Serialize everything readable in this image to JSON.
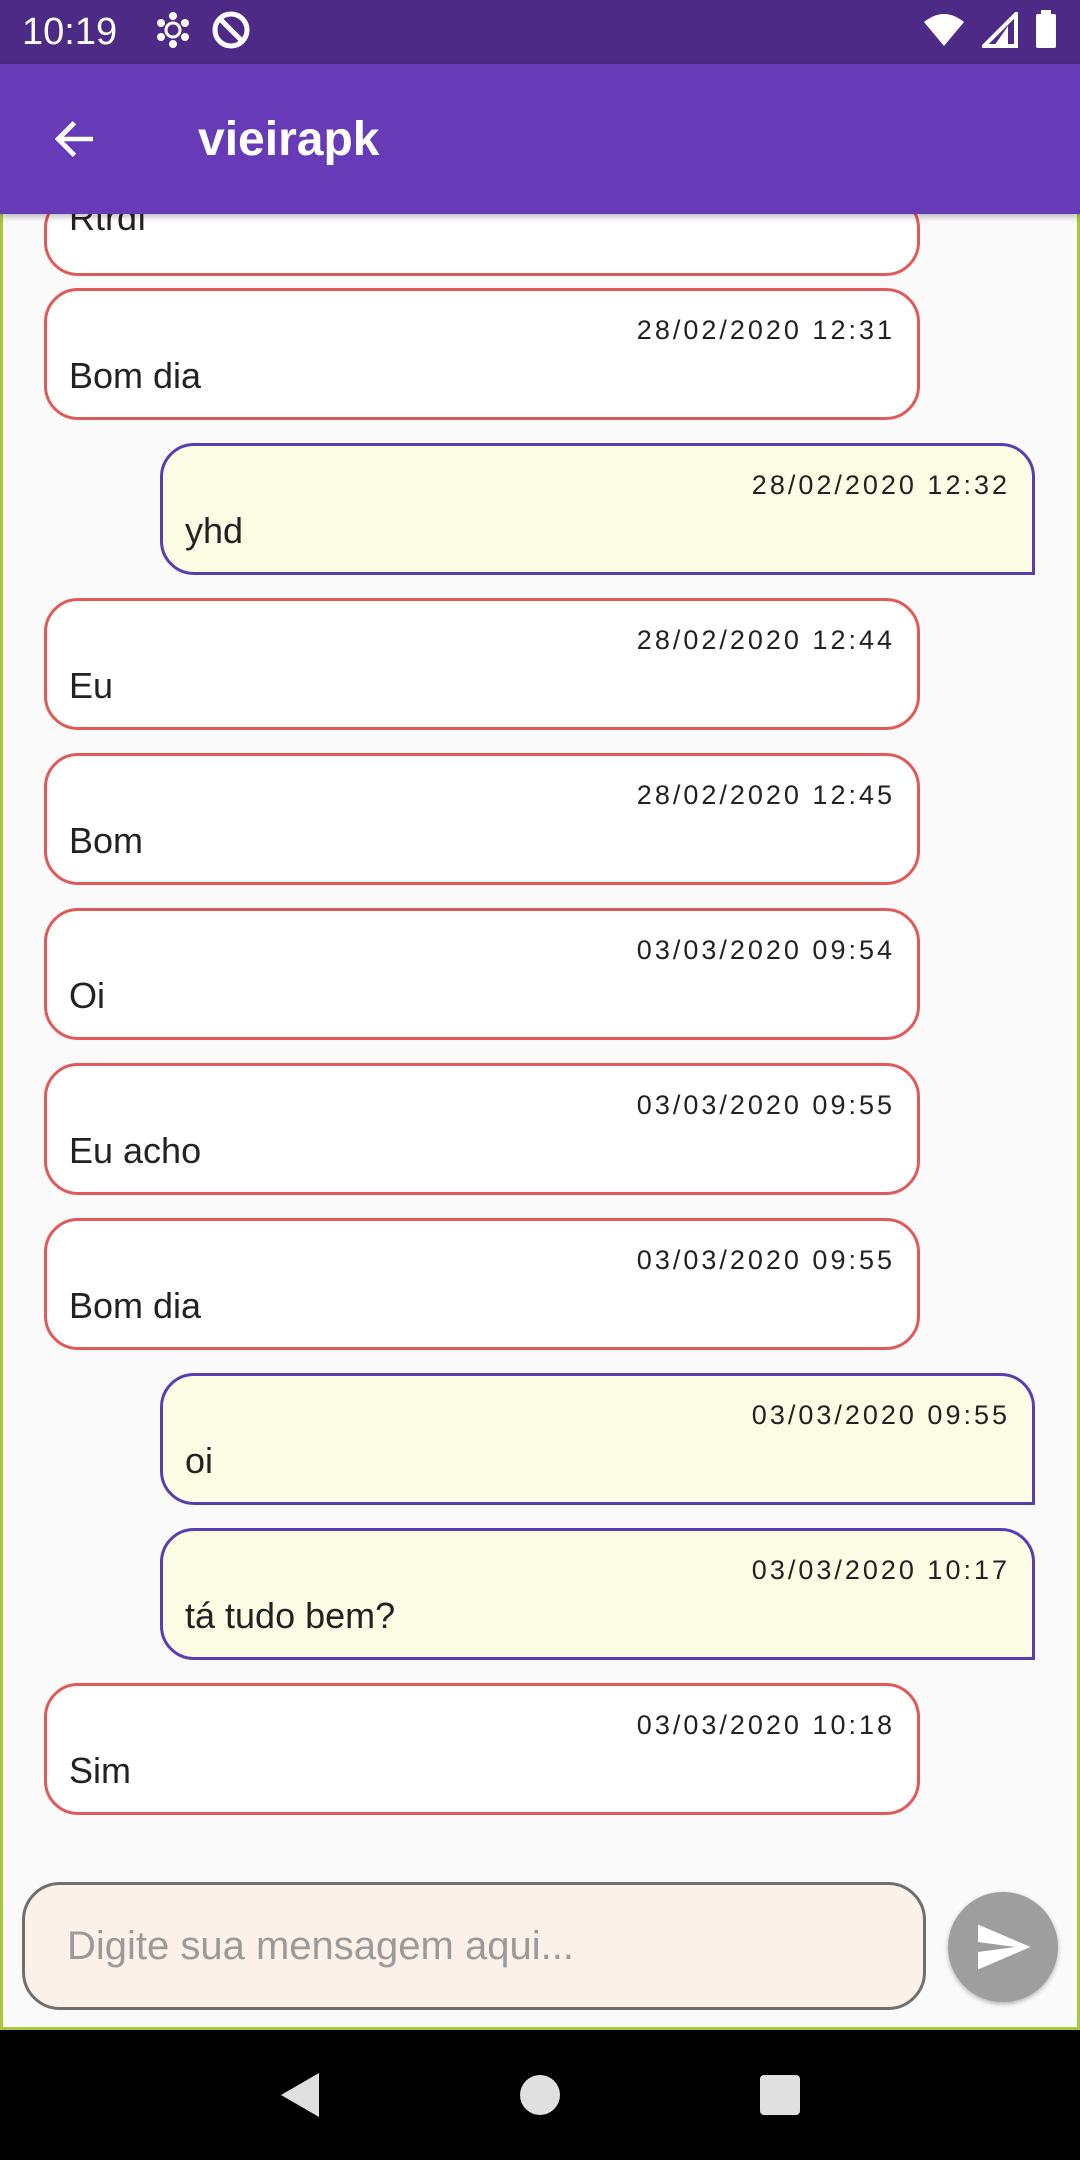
{
  "status_bar": {
    "time": "10:19"
  },
  "app_bar": {
    "title": "vieirapk"
  },
  "messages": [
    {
      "direction": "in",
      "timestamp": "",
      "text": "Rtrdf",
      "partial": true
    },
    {
      "direction": "in",
      "timestamp": "28/02/2020 12:31",
      "text": "Bom dia"
    },
    {
      "direction": "out",
      "timestamp": "28/02/2020 12:32",
      "text": "yhd"
    },
    {
      "direction": "in",
      "timestamp": "28/02/2020 12:44",
      "text": "Eu"
    },
    {
      "direction": "in",
      "timestamp": "28/02/2020 12:45",
      "text": "Bom"
    },
    {
      "direction": "in",
      "timestamp": "03/03/2020 09:54",
      "text": "Oi"
    },
    {
      "direction": "in",
      "timestamp": "03/03/2020 09:55",
      "text": "Eu acho"
    },
    {
      "direction": "in",
      "timestamp": "03/03/2020 09:55",
      "text": "Bom dia"
    },
    {
      "direction": "out",
      "timestamp": "03/03/2020 09:55",
      "text": "oi"
    },
    {
      "direction": "out",
      "timestamp": "03/03/2020 10:17",
      "text": "tá tudo bem?"
    },
    {
      "direction": "in",
      "timestamp": "03/03/2020 10:18",
      "text": "Sim"
    }
  ],
  "composer": {
    "placeholder": "Digite sua mensagem aqui...",
    "value": ""
  },
  "colors": {
    "status_bar": "#4c2a86",
    "app_bar": "#673ab7",
    "incoming_border": "#e05a5a",
    "outgoing_border": "#5a3db0",
    "outgoing_fill": "#fcfce4",
    "send_button": "#9e9e9e"
  },
  "icons": {
    "back": "arrow-back-icon",
    "send": "send-icon",
    "nav_back": "triangle-back-icon",
    "nav_home": "circle-home-icon",
    "nav_recents": "square-recents-icon"
  }
}
